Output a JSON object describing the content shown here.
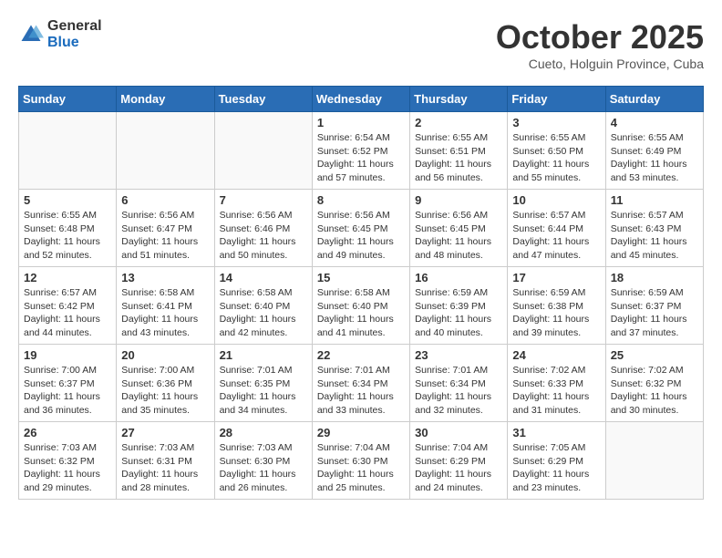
{
  "header": {
    "logo": {
      "text1": "General",
      "text2": "Blue"
    },
    "title": "October 2025",
    "location": "Cueto, Holguin Province, Cuba"
  },
  "weekdays": [
    "Sunday",
    "Monday",
    "Tuesday",
    "Wednesday",
    "Thursday",
    "Friday",
    "Saturday"
  ],
  "weeks": [
    {
      "days": [
        {
          "num": "",
          "sunrise": "",
          "sunset": "",
          "daylight": ""
        },
        {
          "num": "",
          "sunrise": "",
          "sunset": "",
          "daylight": ""
        },
        {
          "num": "",
          "sunrise": "",
          "sunset": "",
          "daylight": ""
        },
        {
          "num": "1",
          "sunrise": "Sunrise: 6:54 AM",
          "sunset": "Sunset: 6:52 PM",
          "daylight": "Daylight: 11 hours and 57 minutes."
        },
        {
          "num": "2",
          "sunrise": "Sunrise: 6:55 AM",
          "sunset": "Sunset: 6:51 PM",
          "daylight": "Daylight: 11 hours and 56 minutes."
        },
        {
          "num": "3",
          "sunrise": "Sunrise: 6:55 AM",
          "sunset": "Sunset: 6:50 PM",
          "daylight": "Daylight: 11 hours and 55 minutes."
        },
        {
          "num": "4",
          "sunrise": "Sunrise: 6:55 AM",
          "sunset": "Sunset: 6:49 PM",
          "daylight": "Daylight: 11 hours and 53 minutes."
        }
      ]
    },
    {
      "days": [
        {
          "num": "5",
          "sunrise": "Sunrise: 6:55 AM",
          "sunset": "Sunset: 6:48 PM",
          "daylight": "Daylight: 11 hours and 52 minutes."
        },
        {
          "num": "6",
          "sunrise": "Sunrise: 6:56 AM",
          "sunset": "Sunset: 6:47 PM",
          "daylight": "Daylight: 11 hours and 51 minutes."
        },
        {
          "num": "7",
          "sunrise": "Sunrise: 6:56 AM",
          "sunset": "Sunset: 6:46 PM",
          "daylight": "Daylight: 11 hours and 50 minutes."
        },
        {
          "num": "8",
          "sunrise": "Sunrise: 6:56 AM",
          "sunset": "Sunset: 6:45 PM",
          "daylight": "Daylight: 11 hours and 49 minutes."
        },
        {
          "num": "9",
          "sunrise": "Sunrise: 6:56 AM",
          "sunset": "Sunset: 6:45 PM",
          "daylight": "Daylight: 11 hours and 48 minutes."
        },
        {
          "num": "10",
          "sunrise": "Sunrise: 6:57 AM",
          "sunset": "Sunset: 6:44 PM",
          "daylight": "Daylight: 11 hours and 47 minutes."
        },
        {
          "num": "11",
          "sunrise": "Sunrise: 6:57 AM",
          "sunset": "Sunset: 6:43 PM",
          "daylight": "Daylight: 11 hours and 45 minutes."
        }
      ]
    },
    {
      "days": [
        {
          "num": "12",
          "sunrise": "Sunrise: 6:57 AM",
          "sunset": "Sunset: 6:42 PM",
          "daylight": "Daylight: 11 hours and 44 minutes."
        },
        {
          "num": "13",
          "sunrise": "Sunrise: 6:58 AM",
          "sunset": "Sunset: 6:41 PM",
          "daylight": "Daylight: 11 hours and 43 minutes."
        },
        {
          "num": "14",
          "sunrise": "Sunrise: 6:58 AM",
          "sunset": "Sunset: 6:40 PM",
          "daylight": "Daylight: 11 hours and 42 minutes."
        },
        {
          "num": "15",
          "sunrise": "Sunrise: 6:58 AM",
          "sunset": "Sunset: 6:40 PM",
          "daylight": "Daylight: 11 hours and 41 minutes."
        },
        {
          "num": "16",
          "sunrise": "Sunrise: 6:59 AM",
          "sunset": "Sunset: 6:39 PM",
          "daylight": "Daylight: 11 hours and 40 minutes."
        },
        {
          "num": "17",
          "sunrise": "Sunrise: 6:59 AM",
          "sunset": "Sunset: 6:38 PM",
          "daylight": "Daylight: 11 hours and 39 minutes."
        },
        {
          "num": "18",
          "sunrise": "Sunrise: 6:59 AM",
          "sunset": "Sunset: 6:37 PM",
          "daylight": "Daylight: 11 hours and 37 minutes."
        }
      ]
    },
    {
      "days": [
        {
          "num": "19",
          "sunrise": "Sunrise: 7:00 AM",
          "sunset": "Sunset: 6:37 PM",
          "daylight": "Daylight: 11 hours and 36 minutes."
        },
        {
          "num": "20",
          "sunrise": "Sunrise: 7:00 AM",
          "sunset": "Sunset: 6:36 PM",
          "daylight": "Daylight: 11 hours and 35 minutes."
        },
        {
          "num": "21",
          "sunrise": "Sunrise: 7:01 AM",
          "sunset": "Sunset: 6:35 PM",
          "daylight": "Daylight: 11 hours and 34 minutes."
        },
        {
          "num": "22",
          "sunrise": "Sunrise: 7:01 AM",
          "sunset": "Sunset: 6:34 PM",
          "daylight": "Daylight: 11 hours and 33 minutes."
        },
        {
          "num": "23",
          "sunrise": "Sunrise: 7:01 AM",
          "sunset": "Sunset: 6:34 PM",
          "daylight": "Daylight: 11 hours and 32 minutes."
        },
        {
          "num": "24",
          "sunrise": "Sunrise: 7:02 AM",
          "sunset": "Sunset: 6:33 PM",
          "daylight": "Daylight: 11 hours and 31 minutes."
        },
        {
          "num": "25",
          "sunrise": "Sunrise: 7:02 AM",
          "sunset": "Sunset: 6:32 PM",
          "daylight": "Daylight: 11 hours and 30 minutes."
        }
      ]
    },
    {
      "days": [
        {
          "num": "26",
          "sunrise": "Sunrise: 7:03 AM",
          "sunset": "Sunset: 6:32 PM",
          "daylight": "Daylight: 11 hours and 29 minutes."
        },
        {
          "num": "27",
          "sunrise": "Sunrise: 7:03 AM",
          "sunset": "Sunset: 6:31 PM",
          "daylight": "Daylight: 11 hours and 28 minutes."
        },
        {
          "num": "28",
          "sunrise": "Sunrise: 7:03 AM",
          "sunset": "Sunset: 6:30 PM",
          "daylight": "Daylight: 11 hours and 26 minutes."
        },
        {
          "num": "29",
          "sunrise": "Sunrise: 7:04 AM",
          "sunset": "Sunset: 6:30 PM",
          "daylight": "Daylight: 11 hours and 25 minutes."
        },
        {
          "num": "30",
          "sunrise": "Sunrise: 7:04 AM",
          "sunset": "Sunset: 6:29 PM",
          "daylight": "Daylight: 11 hours and 24 minutes."
        },
        {
          "num": "31",
          "sunrise": "Sunrise: 7:05 AM",
          "sunset": "Sunset: 6:29 PM",
          "daylight": "Daylight: 11 hours and 23 minutes."
        },
        {
          "num": "",
          "sunrise": "",
          "sunset": "",
          "daylight": ""
        }
      ]
    }
  ]
}
